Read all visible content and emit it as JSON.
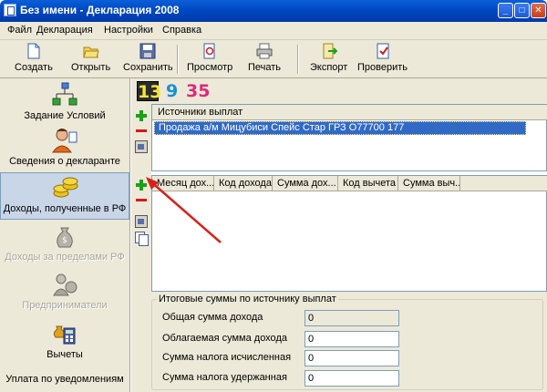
{
  "window": {
    "title": "Без имени - Декларация 2008"
  },
  "menu": [
    "Файл",
    "Декларация",
    "Настройки",
    "Справка"
  ],
  "toolbar": {
    "create": "Создать",
    "open": "Открыть",
    "save": "Сохранить",
    "preview": "Просмотр",
    "print": "Печать",
    "export": "Экспорт",
    "check": "Проверить"
  },
  "sidebar": {
    "items": [
      {
        "label": "Задание Условий",
        "state": "normal"
      },
      {
        "label": "Сведения о декларанте",
        "state": "normal"
      },
      {
        "label": "Доходы, полученные в РФ",
        "state": "active"
      },
      {
        "label": "Доходы за пределами РФ",
        "state": "disabled"
      },
      {
        "label": "Предприниматели",
        "state": "disabled"
      },
      {
        "label": "Вычеты",
        "state": "normal"
      },
      {
        "label": "Уплата по уведомлениям",
        "state": "normal"
      }
    ]
  },
  "tax_rates": [
    "13",
    "9",
    "35"
  ],
  "sources": {
    "header": "Источники выплат",
    "rows": [
      "Продажа а/м Мицубиси Спейс Стар ГРЗ О77700 177"
    ]
  },
  "income": {
    "columns": [
      "Месяц дох...",
      "Код дохода",
      "Сумма дох...",
      "Код вычета",
      "Сумма выч..."
    ]
  },
  "totals": {
    "legend": "Итоговые суммы по источнику выплат",
    "rows": [
      {
        "label": "Общая сумма дохода",
        "value": "0"
      },
      {
        "label": "Облагаемая сумма дохода",
        "value": "0"
      },
      {
        "label": "Сумма налога исчисленная",
        "value": "0"
      },
      {
        "label": "Сумма налога удержанная",
        "value": "0"
      }
    ]
  },
  "colors": {
    "accent": "#316ac5",
    "annotation_arrow": "#d8201c"
  }
}
